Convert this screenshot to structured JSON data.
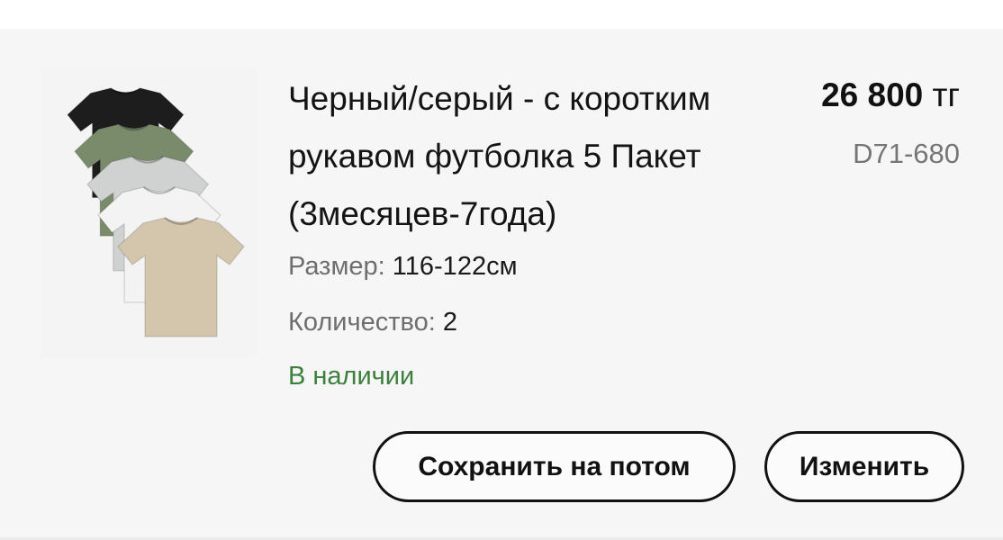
{
  "item": {
    "title": "Черный/серый - с коротким рукавом футболка 5 Пакет (3месяцев-7года)",
    "price_amount": "26 800",
    "price_currency": "тг",
    "sku": "D71-680",
    "size_label": "Размер:",
    "size_value": "116-122см",
    "qty_label": "Количество:",
    "qty_value": "2",
    "stock_status": "В наличии",
    "image_icon": "tshirt-stack-icon",
    "shirt_colors": [
      "#1d1d1d",
      "#7a8b6c",
      "#cfd2d1",
      "#f3f3f3",
      "#d4c6ad"
    ]
  },
  "actions": {
    "save_later": "Сохранить на потом",
    "edit": "Изменить"
  }
}
